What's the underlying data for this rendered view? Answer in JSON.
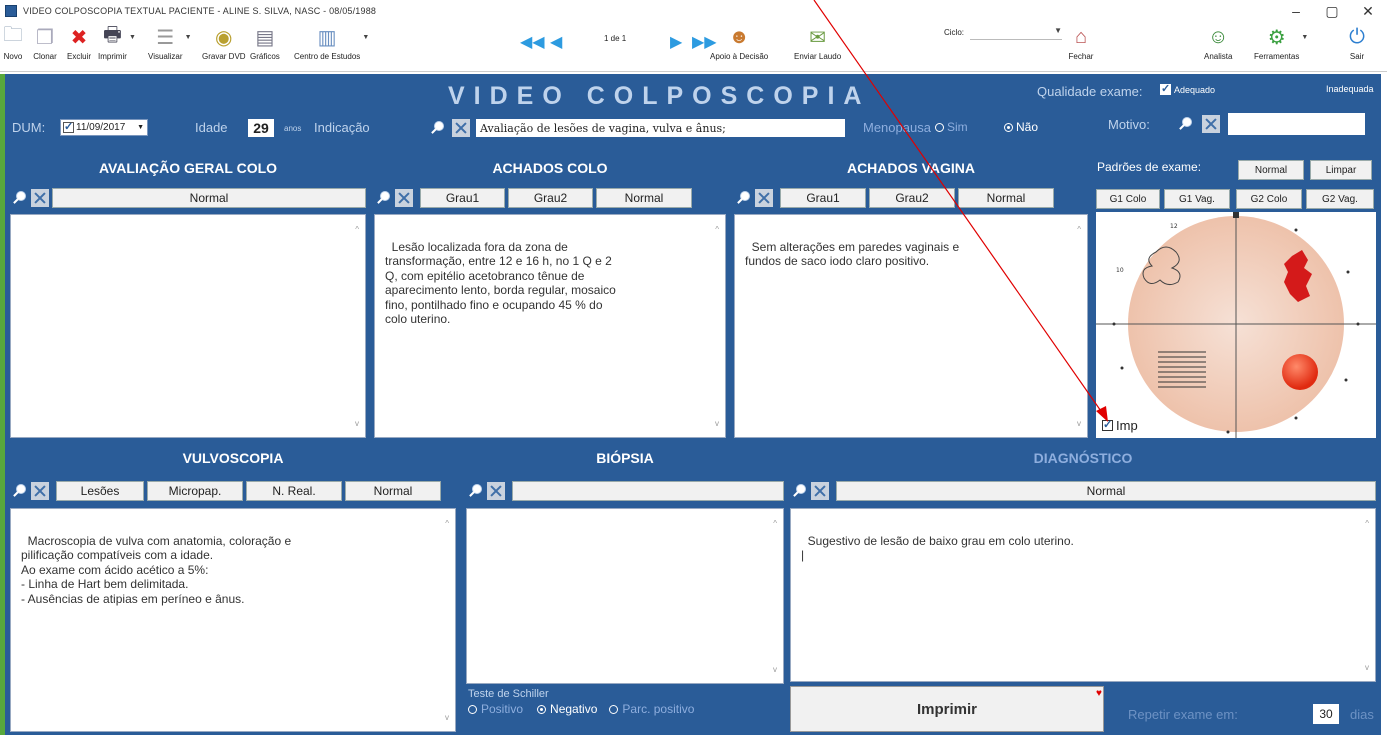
{
  "window": {
    "title": "VIDEO COLPOSCOPIA TEXTUAL    PACIENTE - ALINE S. SILVA,  NASC - 08/05/1988",
    "minimize": "–",
    "maximize": "▢",
    "close": "✕"
  },
  "toolbar": {
    "novo": "Novo",
    "clonar": "Clonar",
    "excluir": "Excluir",
    "imprimir": "Imprimir",
    "visualizar": "Visualizar",
    "gravar_dvd": "Gravar DVD",
    "graficos": "Gráficos",
    "centro_estudos": "Centro de Estudos",
    "pager": "1 de 1",
    "apoio_decisao": "Apoio à Decisão",
    "enviar_laudo": "Enviar Laudo",
    "ciclo_label": "Ciclo:",
    "ciclo_value": "",
    "fechar": "Fechar",
    "analista": "Analista",
    "ferramentas": "Ferramentas",
    "sair": "Sair"
  },
  "header": {
    "title": "VIDEO COLPOSCOPIA",
    "qualidade_label": "Qualidade exame:",
    "adequado": "Adequado",
    "inadequada": "Inadequada",
    "dum_label": "DUM:",
    "dum_value": "11/09/2017",
    "idade_label": "Idade",
    "idade_value": "29",
    "idade_unit": "anos",
    "indicacao_label": "Indicação",
    "indicacao_value": "Avaliação de lesões de vagina, vulva e ânus;",
    "menopausa_label": "Menopausa",
    "sim": "Sim",
    "nao": "Não",
    "motivo_label": "Motivo:",
    "motivo_value": ""
  },
  "colo": {
    "heading": "AVALIAÇÃO GERAL COLO",
    "btn_normal": "Normal",
    "text": ""
  },
  "achados_colo": {
    "heading": "ACHADOS COLO",
    "btn_grau1": "Grau1",
    "btn_grau2": "Grau2",
    "btn_normal": "Normal",
    "text": "Lesão localizada fora da zona de\ntransformação, entre 12 e 16 h, no 1 Q e 2\nQ, com epitélio acetobranco tênue de\naparecimento lento, borda regular, mosaico\nfino, pontilhado fino e ocupando 45 % do\ncolo uterino."
  },
  "achados_vagina": {
    "heading": "ACHADOS VAGINA",
    "btn_grau1": "Grau1",
    "btn_grau2": "Grau2",
    "btn_normal": "Normal",
    "text": "Sem alterações em paredes vaginais e\nfundos de saco iodo claro positivo."
  },
  "padroes": {
    "label": "Padrões de exame:",
    "normal": "Normal",
    "limpar": "Limpar",
    "g1_colo": "G1 Colo",
    "g1_vag": "G1 Vag.",
    "g2_colo": "G2 Colo",
    "g2_vag": "G2 Vag.",
    "imp_label": "Imp",
    "tick_12": "12",
    "tick_10": "10"
  },
  "vulvoscopia": {
    "heading": "VULVOSCOPIA",
    "btn_lesoes": "Lesões",
    "btn_micropap": "Micropap.",
    "btn_nreal": "N. Real.",
    "btn_normal": "Normal",
    "text": "Macroscopia de vulva com anatomia, coloração e\npilificação compatíveis com a idade.\nAo exame com ácido acético a 5%:\n- Linha de Hart bem delimitada.\n- Ausências de atipias em períneo e ânus."
  },
  "biopsia": {
    "heading": "BIÓPSIA",
    "text": "",
    "schiller_label": "Teste de Schiller",
    "positivo": "Positivo",
    "negativo": "Negativo",
    "parc_positivo": "Parc. positivo"
  },
  "diagnostico": {
    "heading": "DIAGNÓSTICO",
    "btn_normal": "Normal",
    "text": "Sugestivo de lesão de baixo grau em colo uterino.\n|",
    "imprimir": "Imprimir",
    "repetir_label": "Repetir exame em:",
    "repetir_value": "30",
    "dias": "dias"
  },
  "colors": {
    "panel_blue": "#2a5c98",
    "light_text": "#bfd3ec",
    "annotation": "#e00000"
  }
}
